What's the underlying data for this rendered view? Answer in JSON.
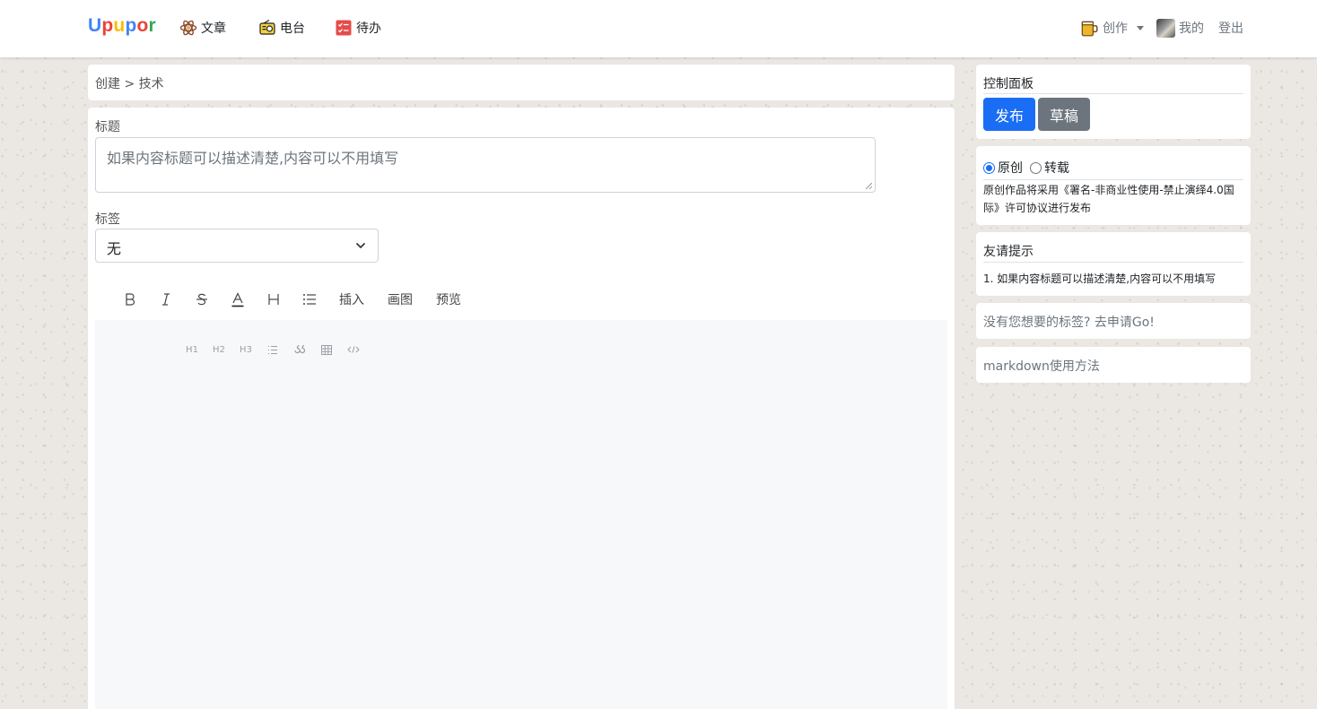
{
  "navbar": {
    "brand": [
      "U",
      "p",
      "u",
      "p",
      "o",
      "r"
    ],
    "items": [
      {
        "label": "文章",
        "icon": "atom-icon"
      },
      {
        "label": "电台",
        "icon": "radio-icon"
      },
      {
        "label": "待办",
        "icon": "checklist-icon"
      }
    ],
    "create_label": "创作",
    "mine_label": "我的",
    "logout_label": "登出"
  },
  "breadcrumb": "创建 > 技术",
  "form": {
    "title_label": "标题",
    "title_placeholder": "如果内容标题可以描述清楚,内容可以不用填写",
    "tag_label": "标签",
    "tag_value": "无"
  },
  "editor": {
    "toolbar": [
      {
        "name": "bold-button",
        "glyph": "B"
      },
      {
        "name": "italic-button",
        "glyph": "I"
      },
      {
        "name": "strikethrough-button",
        "glyph": "S"
      },
      {
        "name": "text-color-button",
        "glyph": "A"
      },
      {
        "name": "heading-button",
        "glyph": "H"
      },
      {
        "name": "list-button",
        "glyph": "☰"
      }
    ],
    "text_buttons": [
      "插入",
      "画图",
      "预览"
    ],
    "mini_toolbar": [
      "H1",
      "H2",
      "H3"
    ]
  },
  "sidebar": {
    "control_title": "控制面板",
    "publish_label": "发布",
    "draft_label": "草稿",
    "original_label": "原创",
    "repost_label": "转载",
    "license_text": "原创作品将采用《署名-非商业性使用-禁止演绎4.0国际》许可协议进行发布",
    "tips_title": "友请提示",
    "tips_text": "1. 如果内容标题可以描述清楚,内容可以不用填写",
    "tag_request": "没有您想要的标签? 去申请Go!",
    "markdown_help": "markdown使用方法"
  },
  "colors": {
    "primary": "#1a6ef5",
    "secondary": "#6c757d",
    "page_bg": "#ebe8e3"
  }
}
